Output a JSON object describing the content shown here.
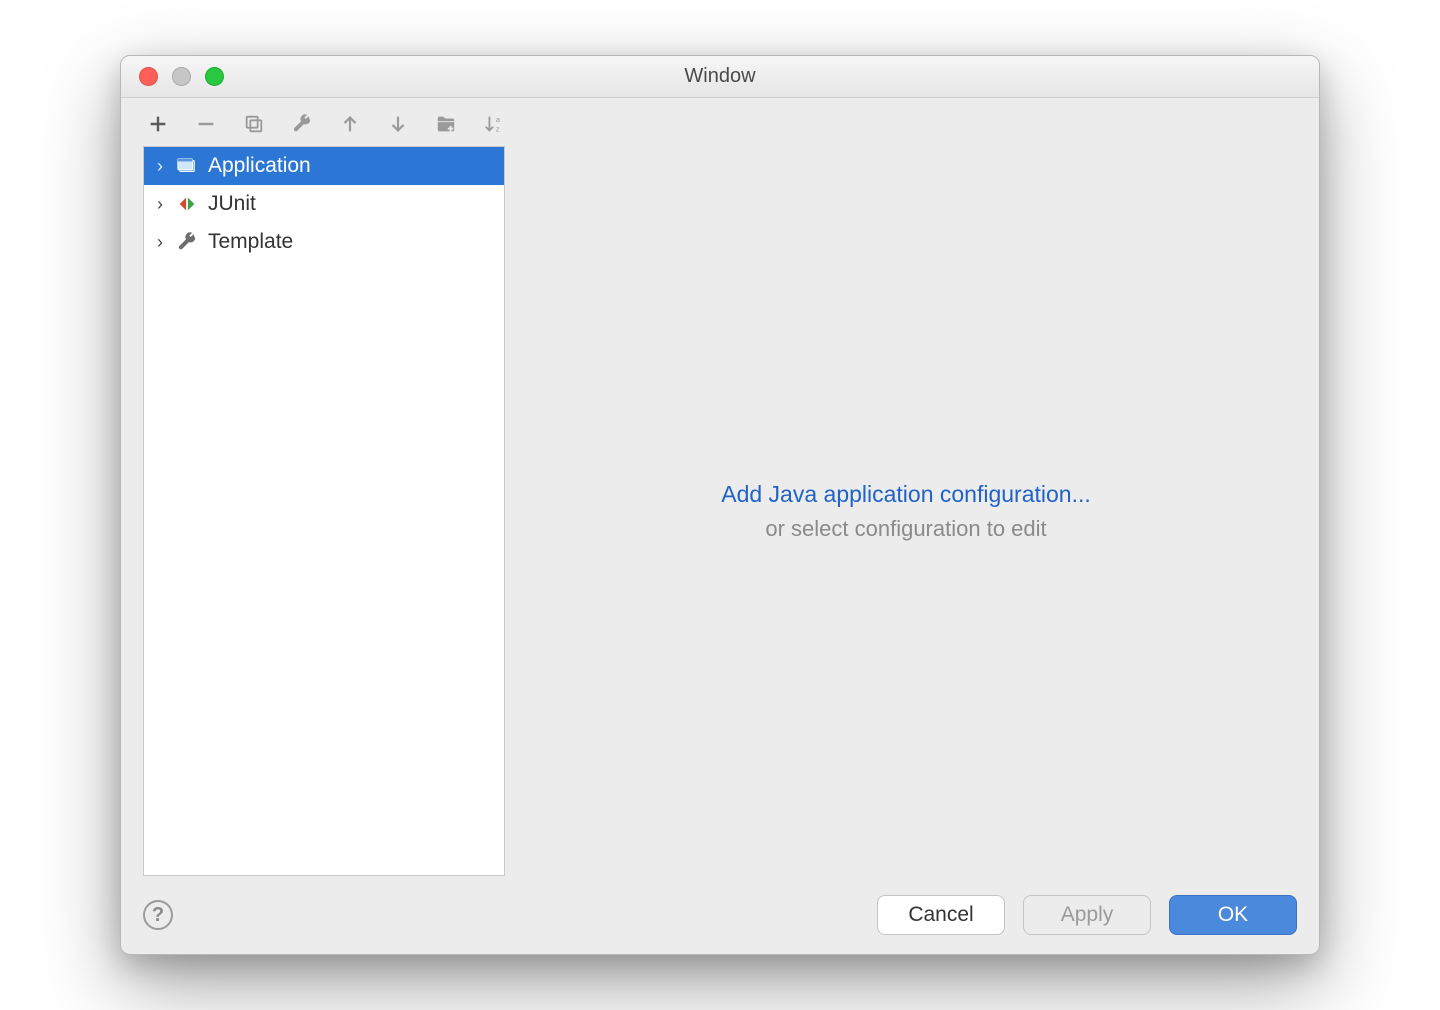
{
  "window": {
    "title": "Window"
  },
  "toolbar": {
    "icons": [
      "plus",
      "minus",
      "copy",
      "wrench",
      "arrow-up",
      "arrow-down",
      "folder-plus",
      "sort-az"
    ]
  },
  "tree": {
    "items": [
      {
        "label": "Application",
        "icon": "app",
        "selected": true
      },
      {
        "label": "JUnit",
        "icon": "junit",
        "selected": false
      },
      {
        "label": "Template",
        "icon": "wrench",
        "selected": false
      }
    ]
  },
  "detail": {
    "link_text": "Add Java application configuration...",
    "hint_text": "or select configuration to edit"
  },
  "footer": {
    "help": "?",
    "cancel": "Cancel",
    "apply": "Apply",
    "ok": "OK"
  }
}
